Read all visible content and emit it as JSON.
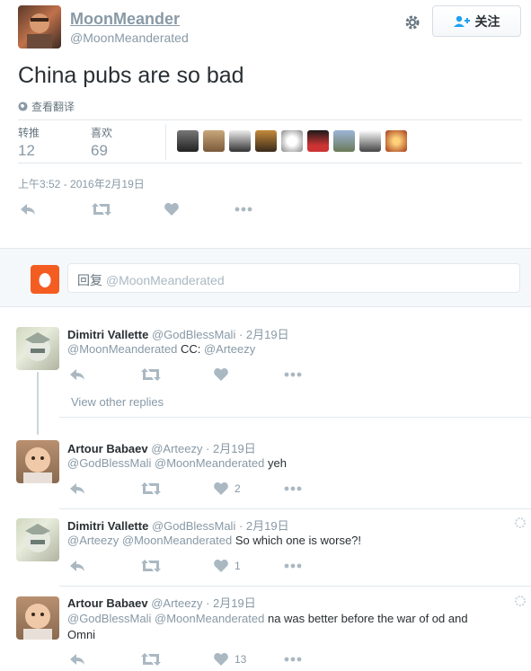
{
  "tweet": {
    "display_name": "MoonMeander",
    "handle": "@MoonMeanderated",
    "follow_label": "关注",
    "text": "China pubs are so bad",
    "translate_label": "查看翻译",
    "retweets_label": "转推",
    "retweets_count": "12",
    "likes_label": "喜欢",
    "likes_count": "69",
    "timestamp": "上午3:52 - 2016年2月19日"
  },
  "reply_box": {
    "prefix": "回复",
    "handle": "@MoonMeanderated"
  },
  "replies": [
    {
      "name": "Dimitri Vallette",
      "handle": "@GodBlessMali",
      "date": "· 2月19日",
      "mentions": "@MoonMeanderated",
      "body": "CC:",
      "trailing_mention": "@Arteezy",
      "likes": "",
      "view_other": "View other replies"
    },
    {
      "name": "Artour Babaev",
      "handle": "@Arteezy",
      "date": "· 2月19日",
      "mentions": "@GodBlessMali @MoonMeanderated",
      "body": "yeh",
      "likes": "2"
    },
    {
      "name": "Dimitri Vallette",
      "handle": "@GodBlessMali",
      "date": "· 2月19日",
      "mentions": "@Arteezy @MoonMeanderated",
      "body": "So which one is worse?!",
      "likes": "1"
    },
    {
      "name": "Artour Babaev",
      "handle": "@Arteezy",
      "date": "· 2月19日",
      "mentions": "@GodBlessMali @MoonMeanderated",
      "body": "na was better before the war of od and",
      "body_line2": "Omni",
      "likes": "13"
    }
  ],
  "colors": {
    "brand": "#1da1f2",
    "muted": "#8899a6",
    "reply_avatar": "#f45d22"
  }
}
